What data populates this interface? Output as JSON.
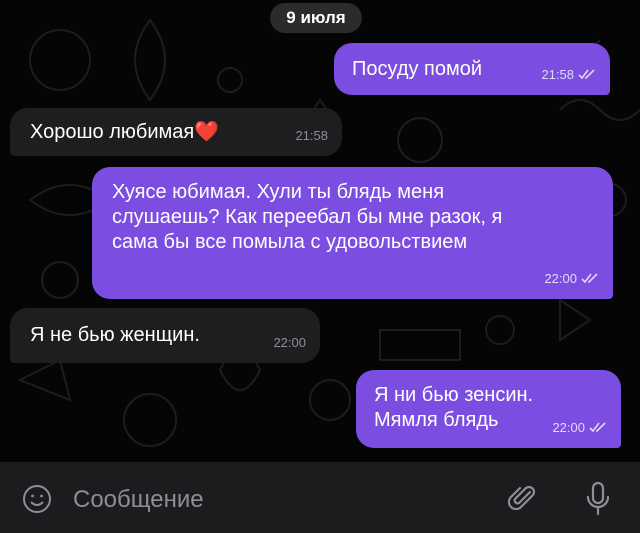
{
  "date_divider": "9 июля",
  "messages": [
    {
      "direction": "out",
      "text": "Посуду помой",
      "time": "21:58",
      "read": true
    },
    {
      "direction": "in",
      "text": "Хорошо любимая❤️",
      "time": "21:58"
    },
    {
      "direction": "out",
      "text": "Хуясе юбимая. Хули ты блядь меня\nслушаешь? Как переебал бы мне разок, я\nсама бы все помыла с удовольствием",
      "time": "22:00",
      "read": true
    },
    {
      "direction": "in",
      "text": "Я не бью женщин.",
      "time": "22:00"
    },
    {
      "direction": "out",
      "text": "Я ни бью зенсин.\nМямля блядь",
      "time": "22:00",
      "read": true
    }
  ],
  "composer": {
    "placeholder": "Сообщение",
    "emoji_icon": "smiley-icon",
    "attach_icon": "paperclip-icon",
    "mic_icon": "microphone-icon"
  },
  "colors": {
    "outgoing_bubble": "#7b4de0",
    "incoming_bubble": "#1e1e21",
    "chat_background": "#050505",
    "input_bar": "#1c1c1e"
  }
}
